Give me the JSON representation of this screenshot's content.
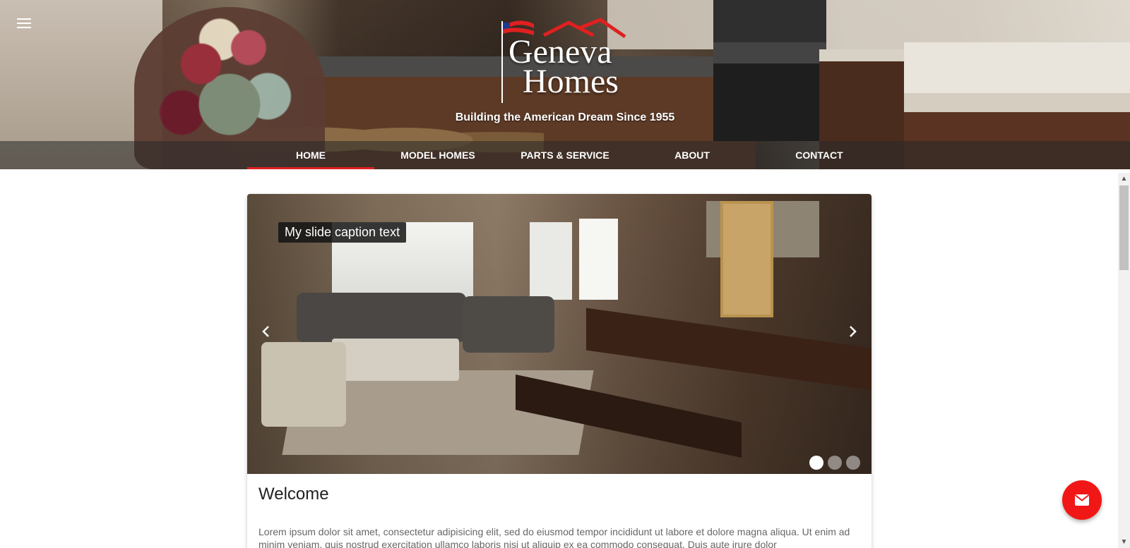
{
  "header": {
    "menu_icon": "hamburger-menu-icon",
    "logo": {
      "word1": "Geneva",
      "word2": "Homes",
      "flag_colors": [
        "#1e3a8a",
        "#e02020",
        "#ffffff"
      ]
    },
    "tagline": "Building the American Dream Since 1955"
  },
  "nav": {
    "items": [
      {
        "label": "HOME",
        "active": true
      },
      {
        "label": "MODEL HOMES",
        "active": false
      },
      {
        "label": "PARTS & SERVICE",
        "active": false
      },
      {
        "label": "ABOUT",
        "active": false
      },
      {
        "label": "CONTACT",
        "active": false
      }
    ],
    "active_indicator_color": "#e02020"
  },
  "carousel": {
    "caption": "My slide caption text",
    "prev_icon": "chevron-left-icon",
    "next_icon": "chevron-right-icon",
    "slide_count": 3,
    "active_slide": 1
  },
  "content": {
    "heading": "Welcome",
    "paragraph": "Lorem ipsum dolor sit amet, consectetur adipisicing elit, sed do eiusmod tempor incididunt ut labore et dolore magna aliqua. Ut enim ad minim veniam, quis nostrud exercitation ullamco laboris nisi ut aliquip ex ea commodo consequat. Duis aute irure dolor"
  },
  "fab": {
    "icon": "mail-icon",
    "color": "#f11717"
  }
}
